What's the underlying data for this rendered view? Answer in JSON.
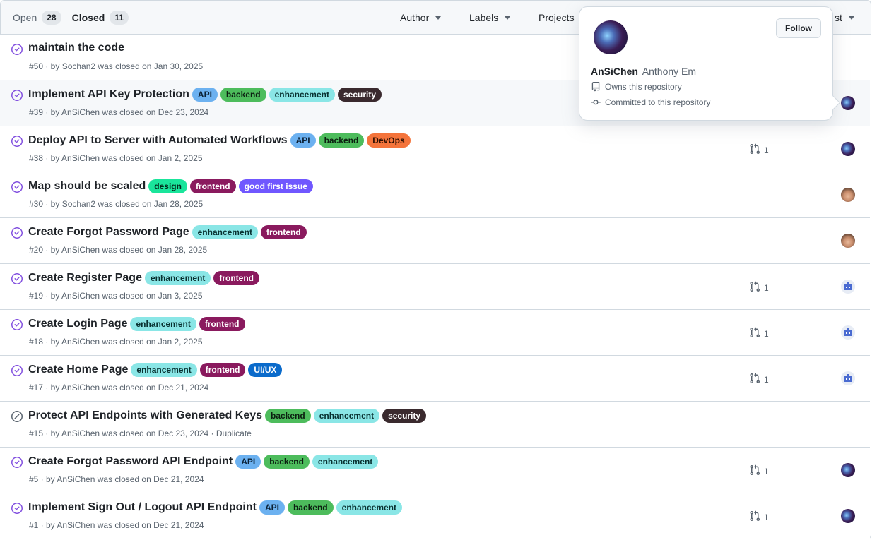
{
  "tabs": {
    "open_label": "Open",
    "open_count": "28",
    "closed_label": "Closed",
    "closed_count": "11"
  },
  "filters": {
    "author": "Author",
    "labels": "Labels",
    "projects": "Projects",
    "sort_tail": "st"
  },
  "popover": {
    "login": "AnSiChen",
    "full_name": "Anthony Em",
    "follow_label": "Follow",
    "owns": "Owns this repository",
    "committed": "Committed to this repository"
  },
  "issues": [
    {
      "title": "maintain the code",
      "meta": "#50 · by Sochan2 was closed on Jan 30, 2025",
      "labels": [],
      "pr": "",
      "avatar": ""
    },
    {
      "title": "Implement API Key Protection",
      "meta": "#39 · by AnSiChen was closed on Dec 23, 2024",
      "labels": [
        {
          "text": "API",
          "bg": "#6cb1f0",
          "fg": "#0a1f33"
        },
        {
          "text": "backend",
          "bg": "#4dbc5c",
          "fg": "#0b1f10"
        },
        {
          "text": "enhancement",
          "bg": "#8ae6e6",
          "fg": "#083030"
        },
        {
          "text": "security",
          "bg": "#3a2a2e",
          "fg": "#ffffff"
        }
      ],
      "pr": "",
      "avatar": "space"
    },
    {
      "title": "Deploy API to Server with Automated Workflows",
      "meta": "#38 · by AnSiChen was closed on Jan 2, 2025",
      "labels": [
        {
          "text": "API",
          "bg": "#6cb1f0",
          "fg": "#0a1f33"
        },
        {
          "text": "backend",
          "bg": "#4dbc5c",
          "fg": "#0b1f10"
        },
        {
          "text": "DevOps",
          "bg": "#f4743b",
          "fg": "#2a0d00"
        }
      ],
      "pr": "1",
      "avatar": "space"
    },
    {
      "title": "Map should be scaled",
      "meta": "#30 · by Sochan2 was closed on Jan 28, 2025",
      "labels": [
        {
          "text": "design",
          "bg": "#1ae59b",
          "fg": "#032b1c"
        },
        {
          "text": "frontend",
          "bg": "#8a1a5e",
          "fg": "#ffffff"
        },
        {
          "text": "good first issue",
          "bg": "#7057ff",
          "fg": "#ffffff"
        }
      ],
      "pr": "",
      "avatar": "face"
    },
    {
      "title": "Create Forgot Password Page",
      "meta": "#20 · by AnSiChen was closed on Jan 28, 2025",
      "labels": [
        {
          "text": "enhancement",
          "bg": "#8ae6e6",
          "fg": "#083030"
        },
        {
          "text": "frontend",
          "bg": "#8a1a5e",
          "fg": "#ffffff"
        }
      ],
      "pr": "",
      "avatar": "face"
    },
    {
      "title": "Create Register Page",
      "meta": "#19 · by AnSiChen was closed on Jan 3, 2025",
      "labels": [
        {
          "text": "enhancement",
          "bg": "#8ae6e6",
          "fg": "#083030"
        },
        {
          "text": "frontend",
          "bg": "#8a1a5e",
          "fg": "#ffffff"
        }
      ],
      "pr": "1",
      "avatar": "bot"
    },
    {
      "title": "Create Login Page",
      "meta": "#18 · by AnSiChen was closed on Jan 2, 2025",
      "labels": [
        {
          "text": "enhancement",
          "bg": "#8ae6e6",
          "fg": "#083030"
        },
        {
          "text": "frontend",
          "bg": "#8a1a5e",
          "fg": "#ffffff"
        }
      ],
      "pr": "1",
      "avatar": "bot"
    },
    {
      "title": "Create Home Page",
      "meta": "#17 · by AnSiChen was closed on Dec 21, 2024",
      "labels": [
        {
          "text": "enhancement",
          "bg": "#8ae6e6",
          "fg": "#083030"
        },
        {
          "text": "frontend",
          "bg": "#8a1a5e",
          "fg": "#ffffff"
        },
        {
          "text": "UI/UX",
          "bg": "#0b6bcb",
          "fg": "#ffffff"
        }
      ],
      "pr": "1",
      "avatar": "bot"
    },
    {
      "title": "Protect API Endpoints with Generated Keys",
      "meta": "#15 · by AnSiChen was closed on Dec 23, 2024 · Duplicate",
      "labels": [
        {
          "text": "backend",
          "bg": "#4dbc5c",
          "fg": "#0b1f10"
        },
        {
          "text": "enhancement",
          "bg": "#8ae6e6",
          "fg": "#083030"
        },
        {
          "text": "security",
          "bg": "#3a2a2e",
          "fg": "#ffffff"
        }
      ],
      "pr": "",
      "avatar": "",
      "state": "not-planned"
    },
    {
      "title": "Create Forgot Password API Endpoint",
      "meta": "#5 · by AnSiChen was closed on Dec 21, 2024",
      "labels": [
        {
          "text": "API",
          "bg": "#6cb1f0",
          "fg": "#0a1f33"
        },
        {
          "text": "backend",
          "bg": "#4dbc5c",
          "fg": "#0b1f10"
        },
        {
          "text": "enhancement",
          "bg": "#8ae6e6",
          "fg": "#083030"
        }
      ],
      "pr": "1",
      "avatar": "space"
    },
    {
      "title": "Implement Sign Out / Logout API Endpoint",
      "meta": "#1 · by AnSiChen was closed on Dec 21, 2024",
      "labels": [
        {
          "text": "API",
          "bg": "#6cb1f0",
          "fg": "#0a1f33"
        },
        {
          "text": "backend",
          "bg": "#4dbc5c",
          "fg": "#0b1f10"
        },
        {
          "text": "enhancement",
          "bg": "#8ae6e6",
          "fg": "#083030"
        }
      ],
      "pr": "1",
      "avatar": "space"
    }
  ]
}
